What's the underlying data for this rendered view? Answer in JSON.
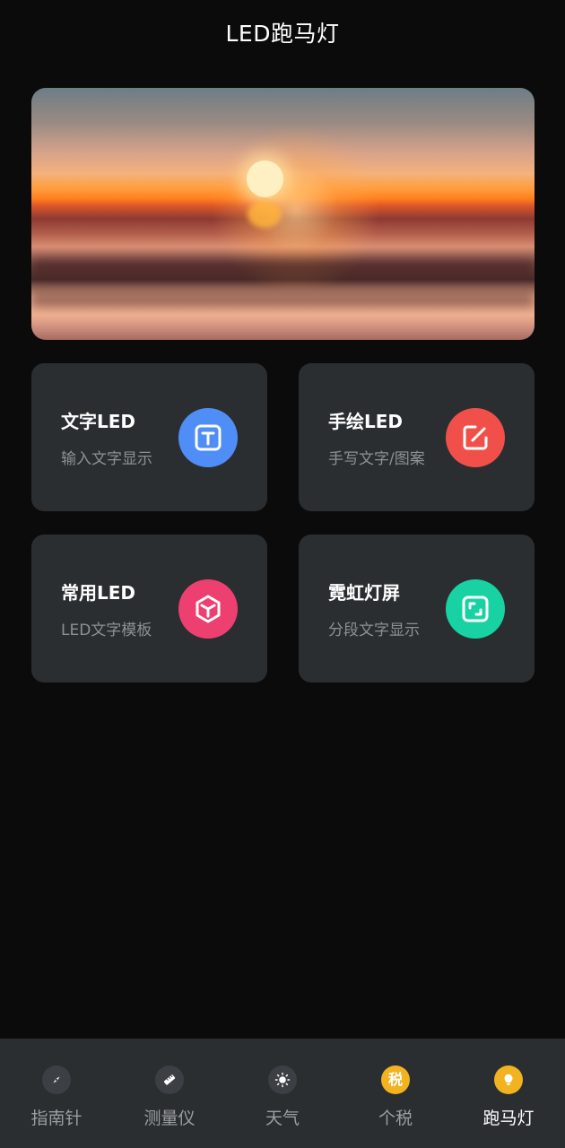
{
  "header": {
    "title": "LED跑马灯"
  },
  "banner": {
    "image": "sunset-over-sea"
  },
  "cards": [
    {
      "title": "文字LED",
      "subtitle": "输入文字显示",
      "icon": "text-t-icon",
      "color": "#4f8ef7"
    },
    {
      "title": "手绘LED",
      "subtitle": "手写文字/图案",
      "icon": "edit-pen-icon",
      "color": "#f1504a"
    },
    {
      "title": "常用LED",
      "subtitle": "LED文字模板",
      "icon": "cube-icon",
      "color": "#ee3f71"
    },
    {
      "title": "霓虹灯屏",
      "subtitle": "分段文字显示",
      "icon": "expand-icon",
      "color": "#19d2a4"
    }
  ],
  "tabs": [
    {
      "label": "指南针",
      "icon": "compass-icon",
      "active": false
    },
    {
      "label": "测量仪",
      "icon": "ruler-icon",
      "active": false
    },
    {
      "label": "天气",
      "icon": "sun-icon",
      "active": false
    },
    {
      "label": "个税",
      "icon": "tax-icon",
      "icon_text": "税",
      "active": false
    },
    {
      "label": "跑马灯",
      "icon": "bulb-icon",
      "active": true
    }
  ],
  "colors": {
    "background": "#0b0b0b",
    "card": "#2b2e31",
    "tabbar": "#2b2e31",
    "subtext": "#8d9095",
    "tab_inactive_icon": "#3c3f44",
    "tab_accent": "#f2b320"
  }
}
